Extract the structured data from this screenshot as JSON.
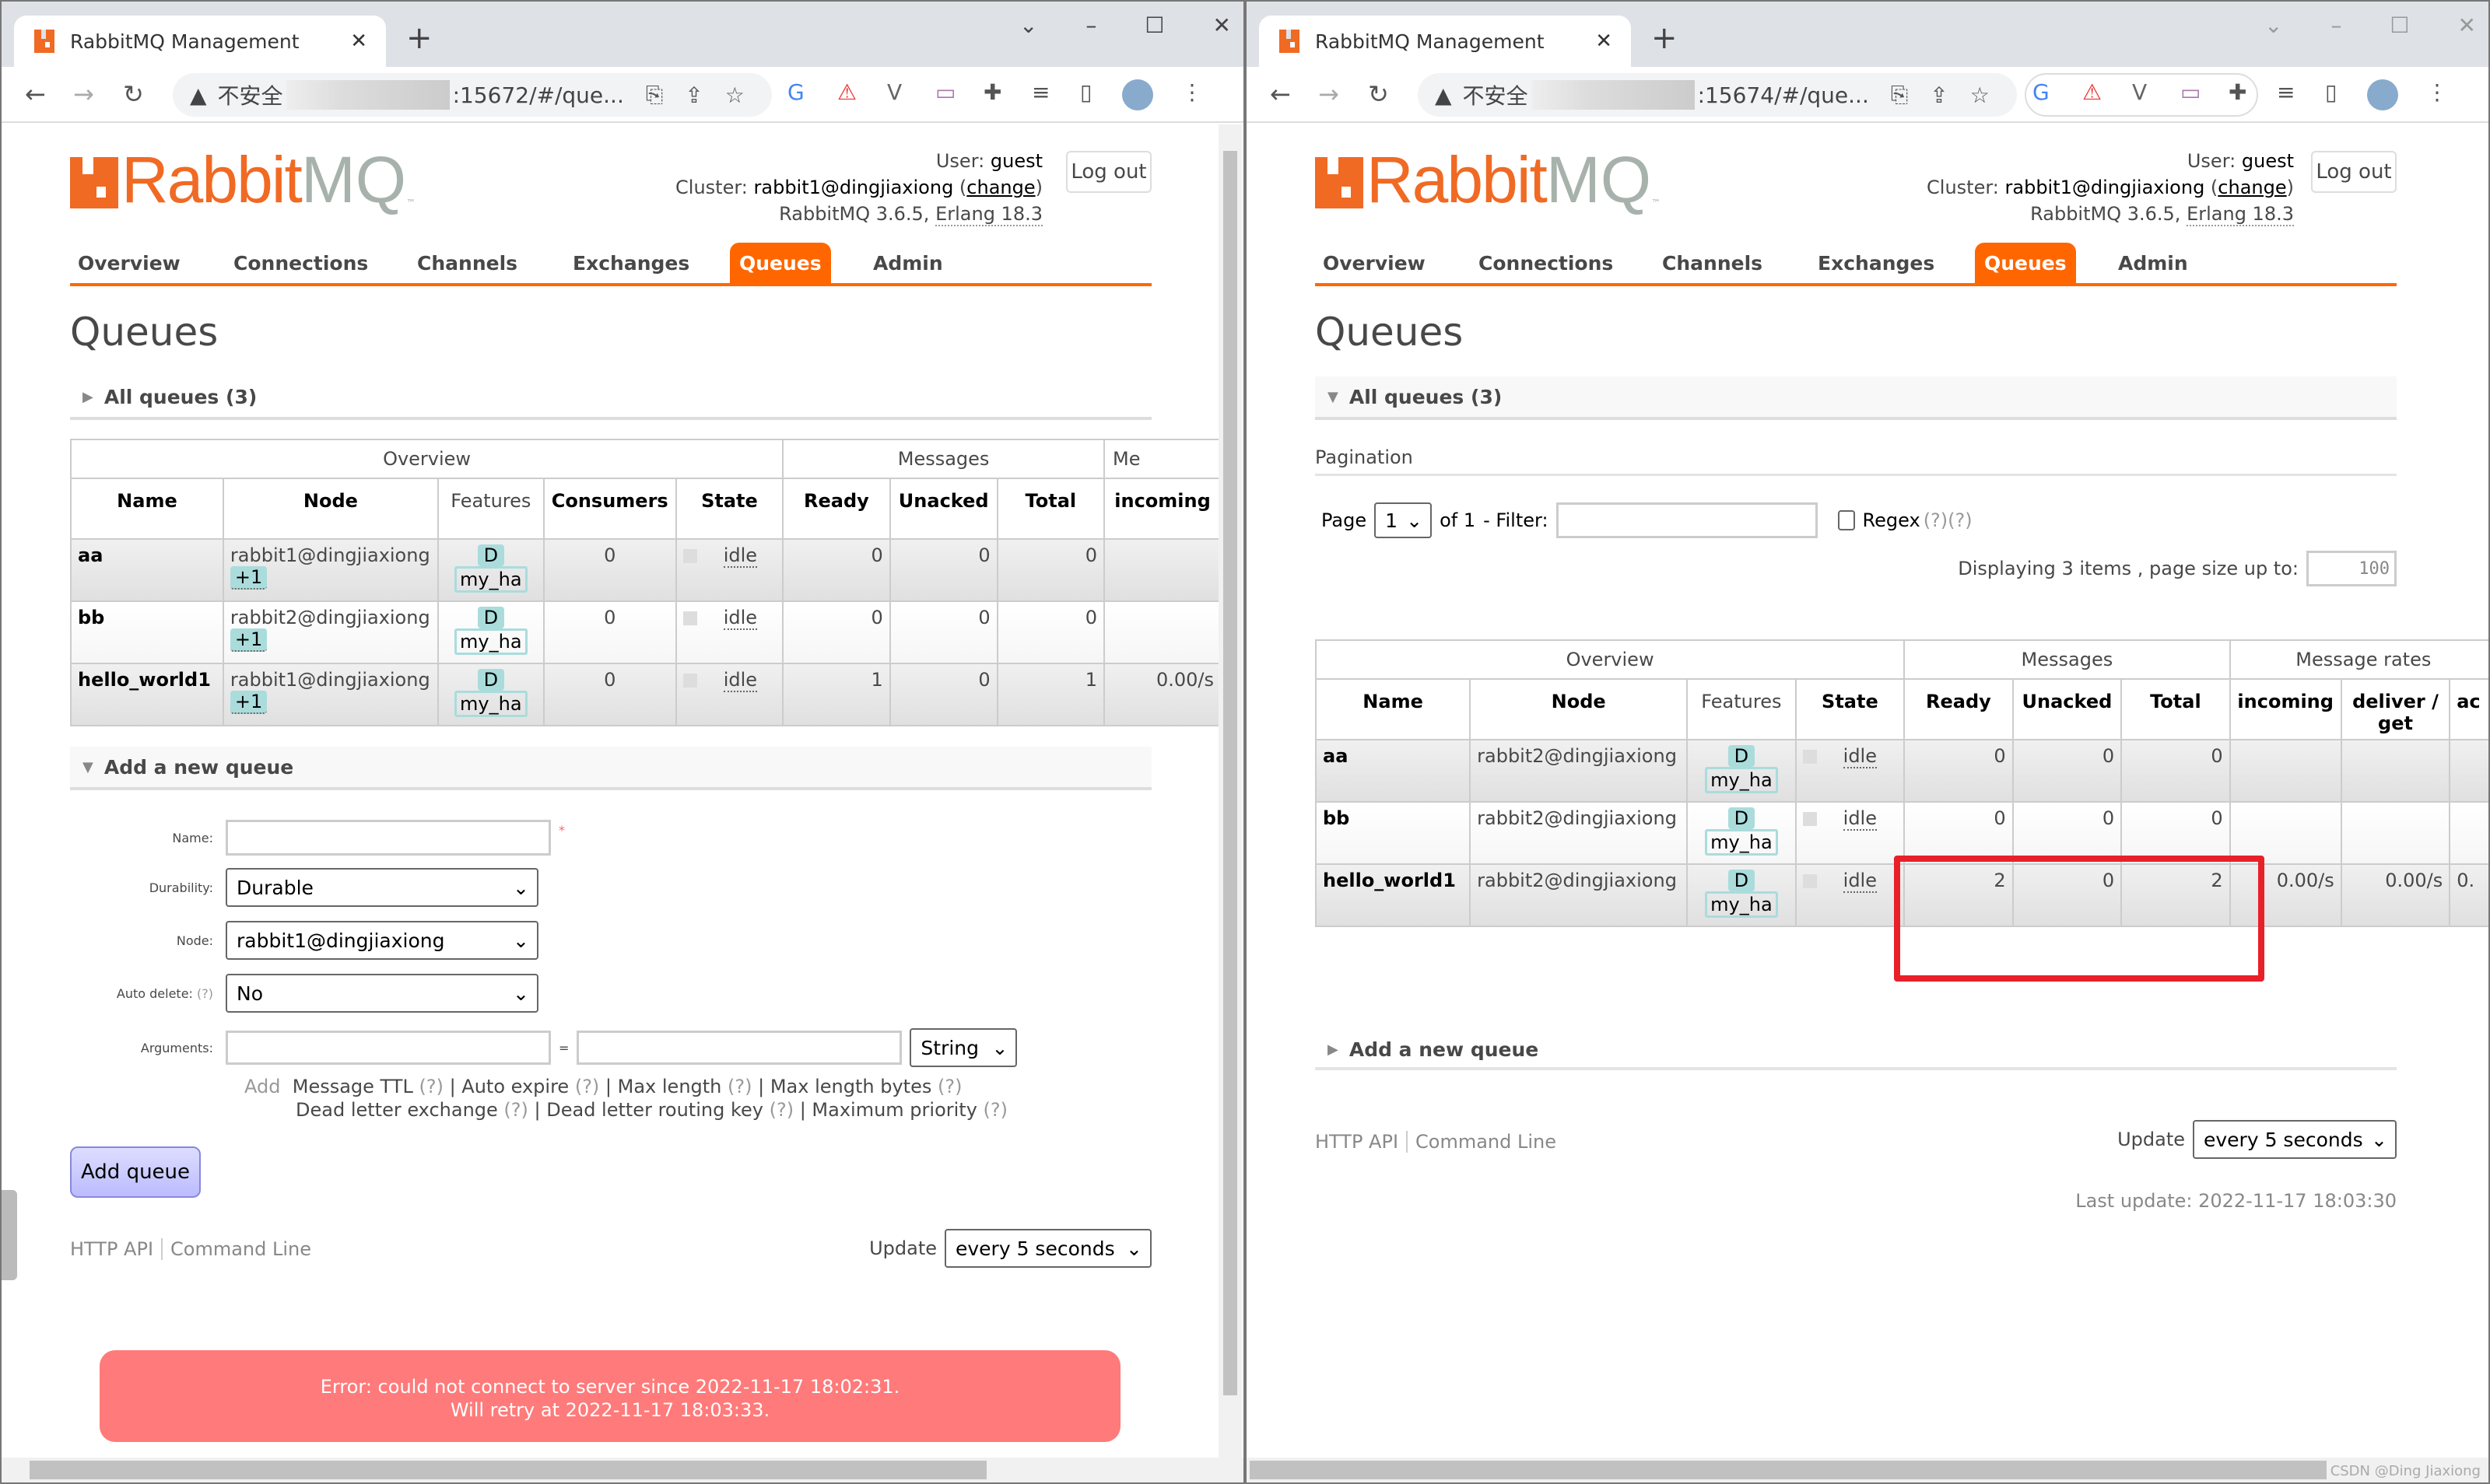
{
  "left": {
    "tab_title": "RabbitMQ Management",
    "url_security": "不安全",
    "url_suffix": ":15672/#/que...",
    "user_label": "User:",
    "user": "guest",
    "cluster_label": "Cluster:",
    "cluster": "rabbit1@dingjiaxiong",
    "change_link": "change",
    "version": "RabbitMQ 3.6.5,",
    "erlang": "Erlang 18.3",
    "logout": "Log out",
    "nav": [
      "Overview",
      "Connections",
      "Channels",
      "Exchanges",
      "Queues",
      "Admin"
    ],
    "page_title": "Queues",
    "all_queues": "All queues (3)",
    "table": {
      "groups": [
        "Overview",
        "Messages",
        "Me"
      ],
      "headers": [
        "Name",
        "Node",
        "Features",
        "Consumers",
        "State",
        "Ready",
        "Unacked",
        "Total",
        "incoming"
      ],
      "rows": [
        {
          "name": "aa",
          "node": "rabbit1@dingjiaxiong",
          "plus": "+1",
          "feat_d": "D",
          "feat_p": "my_ha",
          "consumers": "0",
          "state": "idle",
          "ready": "0",
          "unacked": "0",
          "total": "0",
          "incoming": ""
        },
        {
          "name": "bb",
          "node": "rabbit2@dingjiaxiong",
          "plus": "+1",
          "feat_d": "D",
          "feat_p": "my_ha",
          "consumers": "0",
          "state": "idle",
          "ready": "0",
          "unacked": "0",
          "total": "0",
          "incoming": ""
        },
        {
          "name": "hello_world1",
          "node": "rabbit1@dingjiaxiong",
          "plus": "+1",
          "feat_d": "D",
          "feat_p": "my_ha",
          "consumers": "0",
          "state": "idle",
          "ready": "1",
          "unacked": "0",
          "total": "1",
          "incoming": "0.00/s"
        }
      ]
    },
    "add_queue": {
      "section": "Add a new queue",
      "name_label": "Name:",
      "name_value": "",
      "required": "*",
      "durability_label": "Durability:",
      "durability": "Durable",
      "node_label": "Node:",
      "node": "rabbit1@dingjiaxiong",
      "autodelete_label": "Auto delete:",
      "help": "(?)",
      "autodelete": "No",
      "arguments_label": "Arguments:",
      "equals": "=",
      "arg_type": "String",
      "add_word": "Add",
      "args_line1": [
        {
          "label": "Message TTL"
        },
        {
          "label": "Auto expire"
        },
        {
          "label": "Max length"
        },
        {
          "label": "Max length bytes"
        }
      ],
      "args_line2": [
        {
          "label": "Dead letter exchange"
        },
        {
          "label": "Dead letter routing key"
        },
        {
          "label": "Maximum priority"
        }
      ],
      "button": "Add queue"
    },
    "footer": {
      "http_api": "HTTP API",
      "command_line": "Command Line",
      "update_label": "Update",
      "update_value": "every 5 seconds"
    },
    "error": {
      "line1": "Error: could not connect to server since 2022-11-17 18:02:31.",
      "line2": "Will retry at 2022-11-17 18:03:33."
    }
  },
  "right": {
    "tab_title": "RabbitMQ Management",
    "url_security": "不安全",
    "url_suffix": ":15674/#/que...",
    "user_label": "User:",
    "user": "guest",
    "cluster_label": "Cluster:",
    "cluster": "rabbit1@dingjiaxiong",
    "change_link": "change",
    "version": "RabbitMQ 3.6.5,",
    "erlang": "Erlang 18.3",
    "logout": "Log out",
    "nav": [
      "Overview",
      "Connections",
      "Channels",
      "Exchanges",
      "Queues",
      "Admin"
    ],
    "page_title": "Queues",
    "all_queues": "All queues (3)",
    "pagination": {
      "title": "Pagination",
      "page_label": "Page",
      "page_value": "1",
      "of": "of 1",
      "filter_label": "- Filter:",
      "filter_value": "",
      "regex_label": "Regex",
      "regex_help": "(?)(?)",
      "displaying": "Displaying 3 items , page size up to:",
      "page_size": "100"
    },
    "table": {
      "groups": [
        "Overview",
        "Messages",
        "Message rates"
      ],
      "headers": [
        "Name",
        "Node",
        "Features",
        "State",
        "Ready",
        "Unacked",
        "Total",
        "incoming",
        "deliver / get",
        "ac"
      ],
      "rows": [
        {
          "name": "aa",
          "node": "rabbit2@dingjiaxiong",
          "feat_d": "D",
          "feat_p": "my_ha",
          "state": "idle",
          "ready": "0",
          "unacked": "0",
          "total": "0",
          "incoming": "",
          "deliver": "",
          "ack": ""
        },
        {
          "name": "bb",
          "node": "rabbit2@dingjiaxiong",
          "feat_d": "D",
          "feat_p": "my_ha",
          "state": "idle",
          "ready": "0",
          "unacked": "0",
          "total": "0",
          "incoming": "",
          "deliver": "",
          "ack": ""
        },
        {
          "name": "hello_world1",
          "node": "rabbit2@dingjiaxiong",
          "feat_d": "D",
          "feat_p": "my_ha",
          "state": "idle",
          "ready": "2",
          "unacked": "0",
          "total": "2",
          "incoming": "0.00/s",
          "deliver": "0.00/s",
          "ack": "0."
        }
      ]
    },
    "add_queue_section": "Add a new queue",
    "footer": {
      "http_api": "HTTP API",
      "command_line": "Command Line",
      "update_label": "Update",
      "update_value": "every 5 seconds",
      "last_update": "Last update: 2022-11-17 18:03:30"
    },
    "watermark": "CSDN @Ding Jiaxiong"
  },
  "colors": {
    "accent": "#ff6600",
    "error_bg": "#ff7a7a",
    "highlight": "#e8202a",
    "feature_tag": "#aadcdc"
  }
}
